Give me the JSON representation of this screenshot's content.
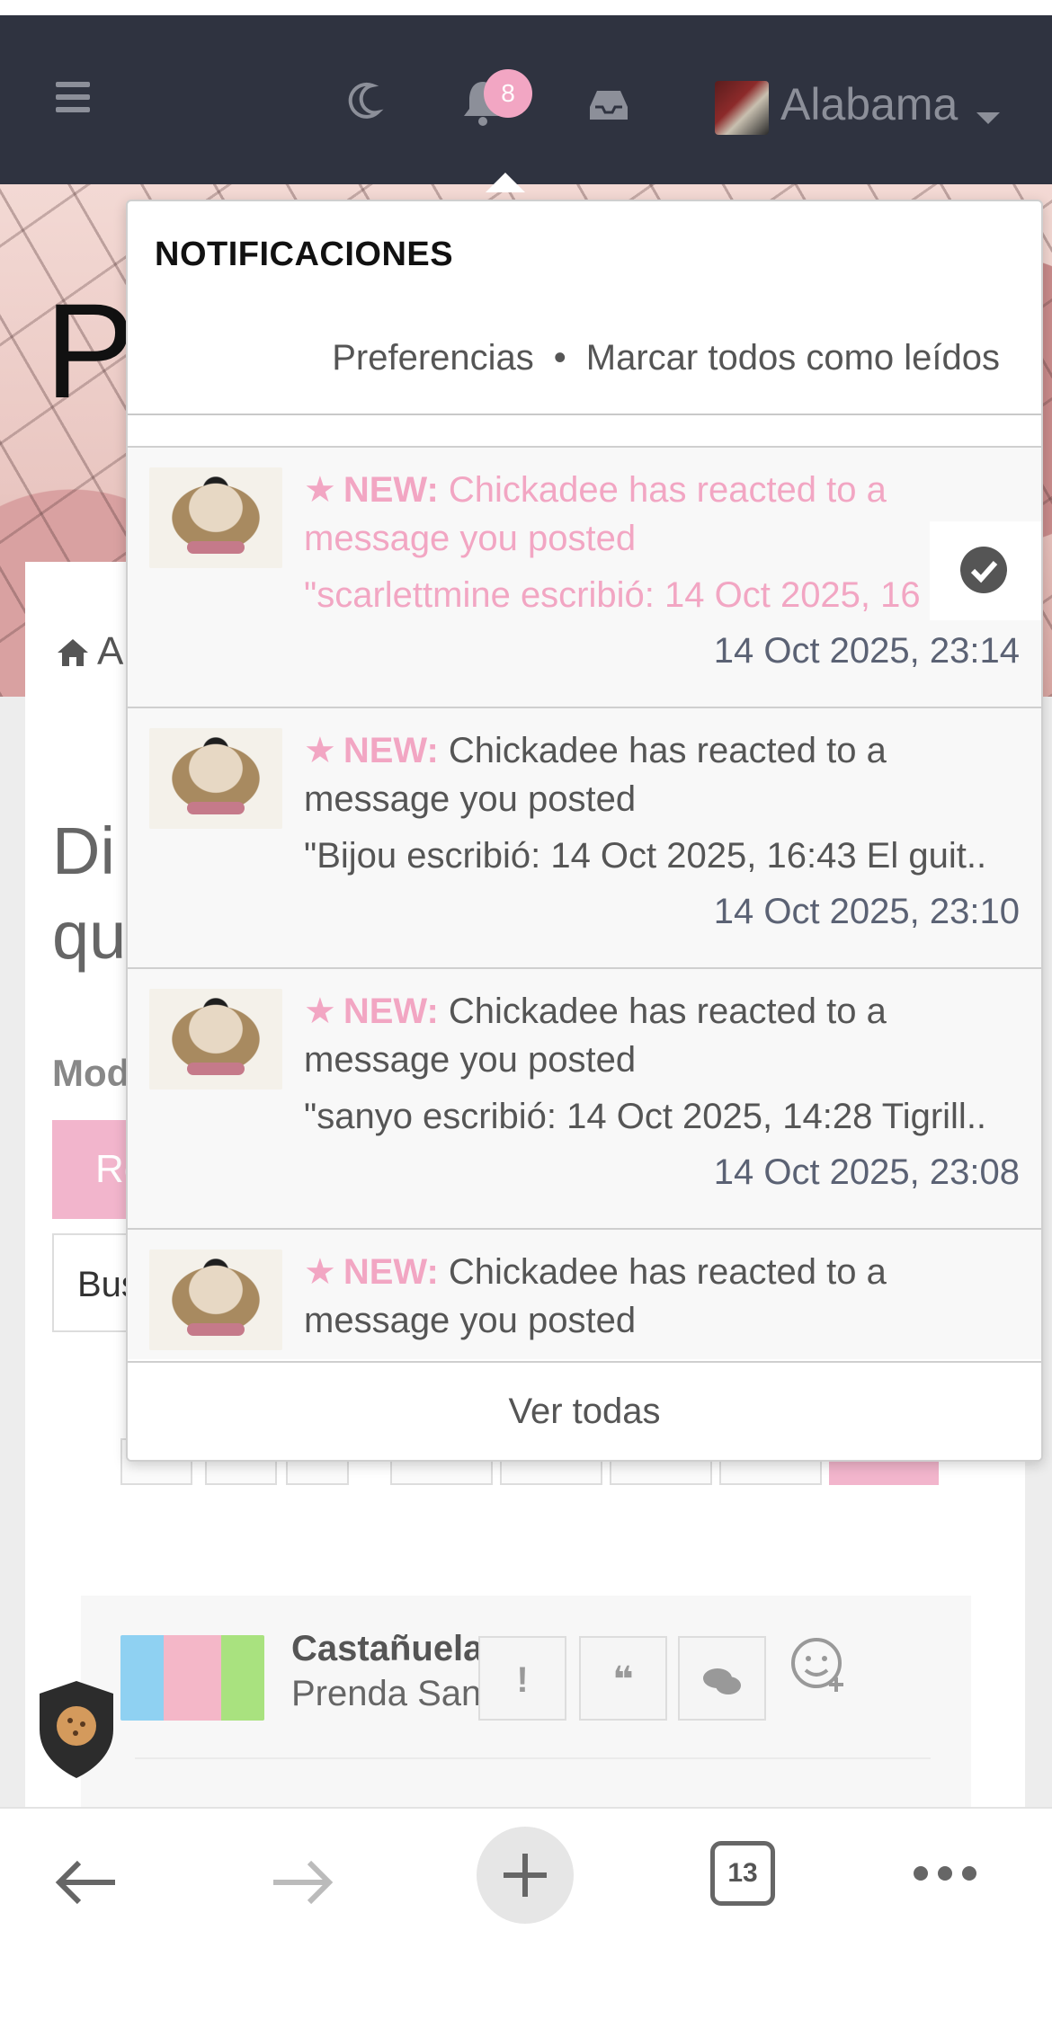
{
  "navbar": {
    "notification_count": "8",
    "username": "Alabama",
    "icons": [
      "hamburger-menu-icon",
      "moon-icon",
      "bell-icon",
      "inbox-icon",
      "caret-down-icon"
    ]
  },
  "page": {
    "hero_letter": "P",
    "breadcrumb_partial": "A",
    "heading_partial_line1": "Di",
    "heading_partial_line2": "qu",
    "mod_label_partial": "Mod",
    "primary_button_partial": "Re",
    "search_partial": "Bus"
  },
  "post": {
    "author_partial": "Castañuela",
    "rank_partial": "Prenda San",
    "report_label": "!",
    "quote_label": "❝",
    "reply_label": "chat-bubbles-icon",
    "react_label": "add-reaction-icon"
  },
  "notifications": {
    "title": "NOTIFICACIONES",
    "preferences_label": "Preferencias",
    "separator": "•",
    "mark_all_label": "Marcar todos como leídos",
    "footer_label": "Ver todas",
    "items": [
      {
        "new_label": "NEW:",
        "text": "Chickadee has reacted to a message you posted",
        "quote": "\"scarlettmine escribió: 14 Oct 2025, 16",
        "time": "14 Oct 2025, 23:14",
        "unread": true
      },
      {
        "new_label": "NEW:",
        "text": "Chickadee has reacted to a message you posted",
        "quote": "\"Bijou escribió: 14 Oct 2025, 16:43 El guit..",
        "time": "14 Oct 2025, 23:10",
        "unread": false
      },
      {
        "new_label": "NEW:",
        "text": "Chickadee has reacted to a message you posted",
        "quote": "\"sanyo escribió: 14 Oct 2025, 14:28 Tigrill..",
        "time": "14 Oct 2025, 23:08",
        "unread": false
      },
      {
        "new_label": "NEW:",
        "text": "Chickadee has reacted to a message you posted",
        "quote": "",
        "time": "",
        "unread": false
      }
    ]
  },
  "browser": {
    "tab_count": "13"
  },
  "colors": {
    "navbar_bg": "#2f3340",
    "accent_pink": "#f2a6c3",
    "timestamp": "#5b6274"
  }
}
